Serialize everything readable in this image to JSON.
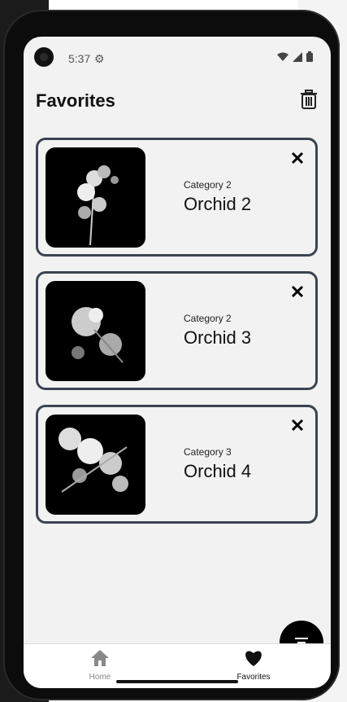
{
  "status_bar": {
    "time": "5:37",
    "icons": [
      "settings-icon",
      "wifi-icon",
      "cell-signal-icon",
      "battery-icon"
    ]
  },
  "app_bar": {
    "title": "Favorites",
    "action_icon": "trash-icon"
  },
  "favorites": [
    {
      "category": "Category 2",
      "name": "Orchid 2"
    },
    {
      "category": "Category 2",
      "name": "Orchid 3"
    },
    {
      "category": "Category 3",
      "name": "Orchid 4"
    }
  ],
  "fab": {
    "icon": "filter-icon"
  },
  "bottom_nav": {
    "items": [
      {
        "label": "Home",
        "icon": "home-icon",
        "active": false
      },
      {
        "label": "Favorites",
        "icon": "heart-icon",
        "active": true
      }
    ]
  },
  "colors": {
    "card_border": "#3c4351",
    "background": "#f2f2f2",
    "fab": "#000000"
  }
}
